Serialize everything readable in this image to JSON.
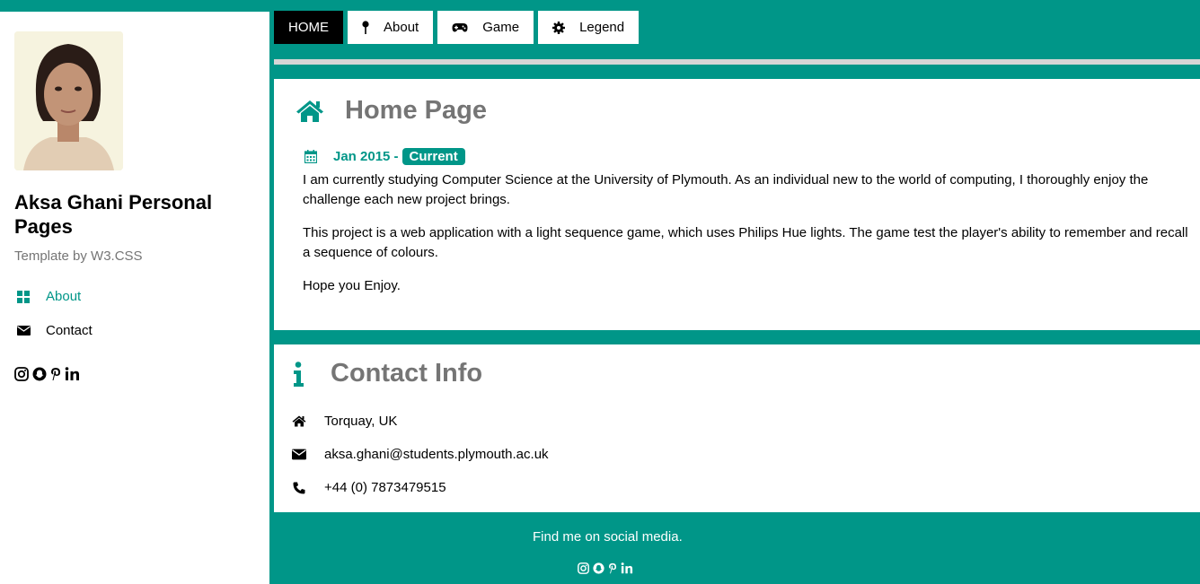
{
  "sidebar": {
    "photo_alt": "Profile photo",
    "name": "Aksa Ghani Personal Pages",
    "template_credit": "Template by W3.CSS",
    "items": [
      {
        "label": "About",
        "icon": "grid-icon",
        "color": "#009688"
      },
      {
        "label": "Contact",
        "icon": "envelope-icon",
        "color": "#000000"
      }
    ],
    "social_icons": [
      "instagram-icon",
      "snapchat-icon",
      "pinterest-icon",
      "linkedin-icon"
    ]
  },
  "nav": {
    "tabs": [
      {
        "label": "HOME",
        "icon": "",
        "active": true
      },
      {
        "label": "About",
        "icon": "pin-icon",
        "active": false
      },
      {
        "label": "Game",
        "icon": "gamepad-icon",
        "active": false
      },
      {
        "label": "Legend",
        "icon": "gear-icon",
        "active": false
      }
    ]
  },
  "home": {
    "title": "Home Page",
    "title_icon": "home-icon",
    "date": "Jan 2015 -",
    "badge": "Current",
    "paragraphs": [
      "I am currently studying Computer Science at the University of Plymouth. As an individual new to the world of computing, I thoroughly enjoy the challenge each new project brings.",
      "This project is a web application with a light sequence game, which uses Philips Hue lights. The game test the player's ability to remember and recall a sequence of colours.",
      "Hope you Enjoy."
    ]
  },
  "contact": {
    "title": "Contact Info",
    "title_icon": "info-icon",
    "location": "Torquay, UK",
    "email": "aksa.ghani@students.plymouth.ac.uk",
    "phone": "+44 (0) 7873479515"
  },
  "footer": {
    "text": "Find me on social media."
  },
  "colors": {
    "accent": "#009688",
    "heading_gray": "#757575",
    "nav_active_bg": "#000000"
  }
}
